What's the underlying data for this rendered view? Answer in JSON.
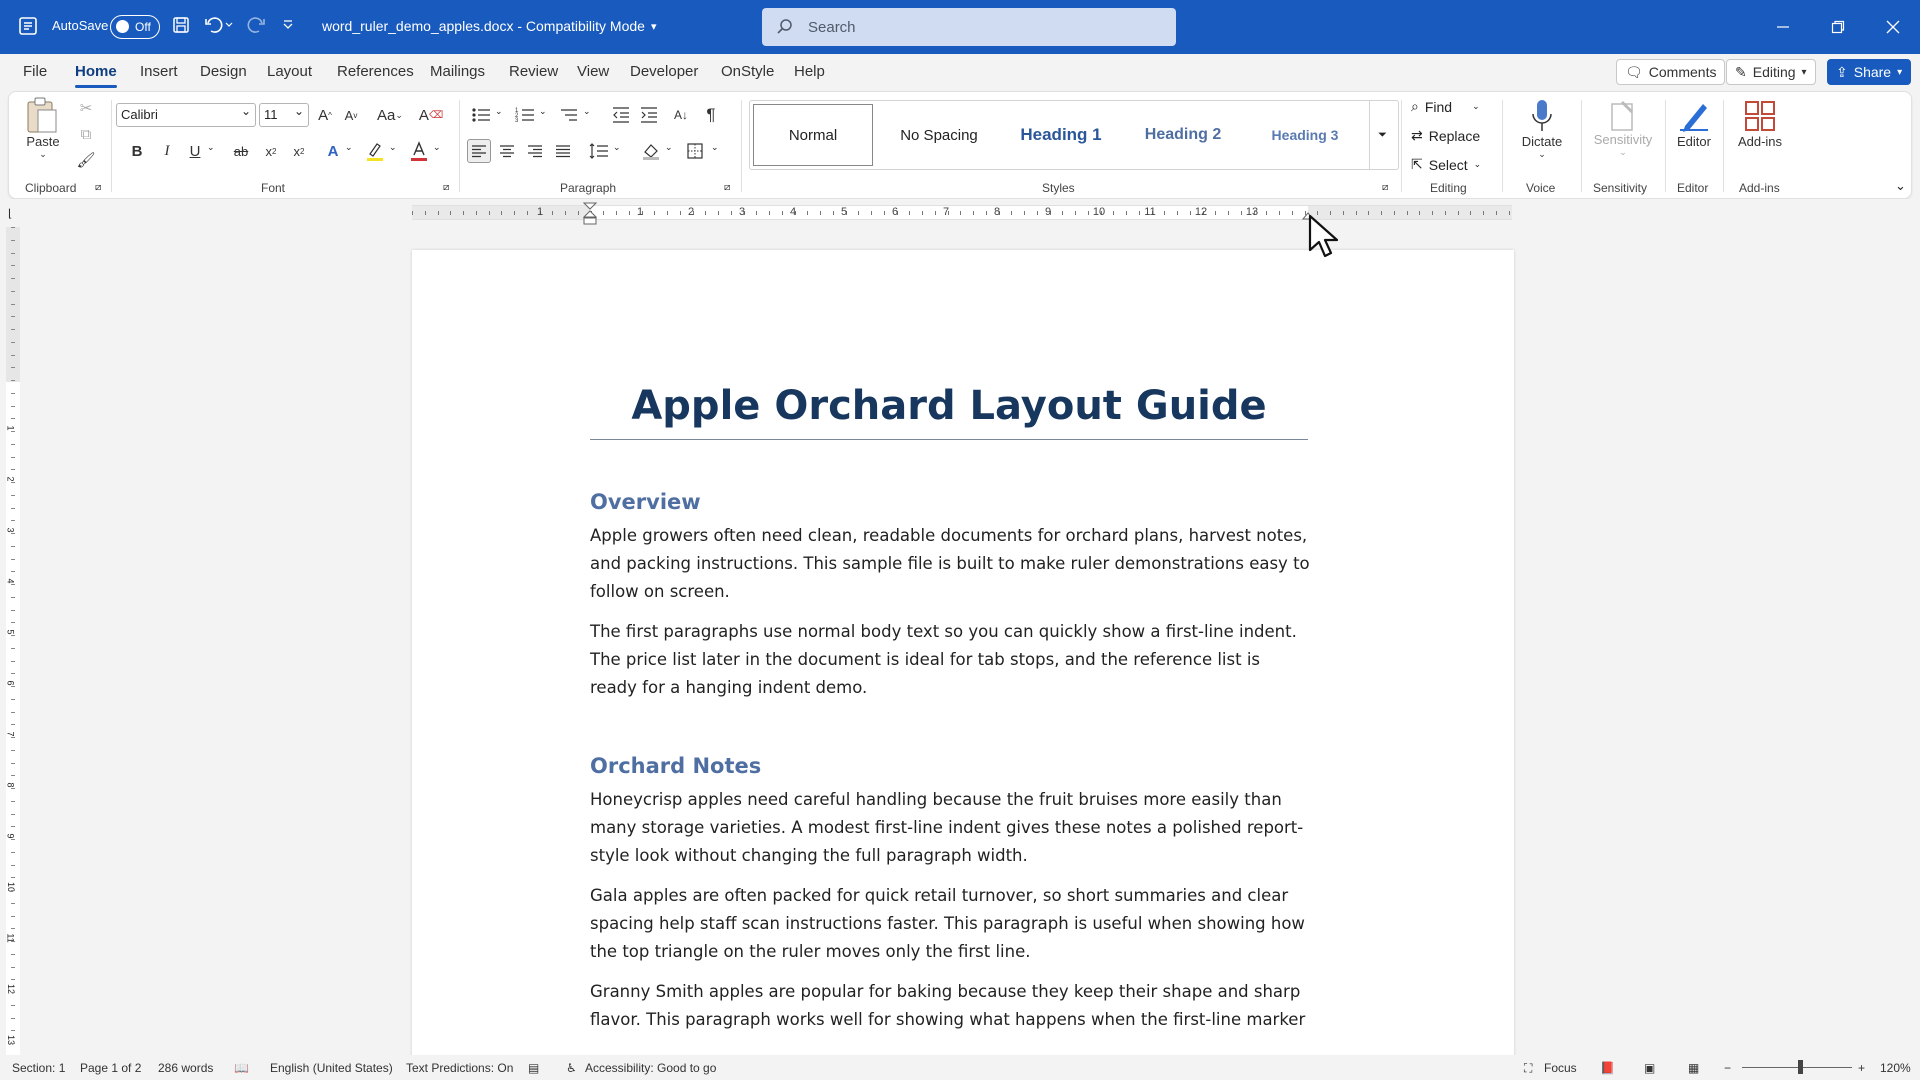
{
  "titlebar": {
    "autosave_label": "AutoSave",
    "autosave_state": "Off",
    "doc_title": "word_ruler_demo_apples.docx  -  Compatibility Mode",
    "search_placeholder": "Search"
  },
  "tabs": [
    "File",
    "Home",
    "Insert",
    "Design",
    "Layout",
    "References",
    "Mailings",
    "Review",
    "View",
    "Developer",
    "OnStyle",
    "Help"
  ],
  "topright": {
    "comments": "Comments",
    "editing": "Editing",
    "share": "Share"
  },
  "ribbon": {
    "clipboard": {
      "paste": "Paste",
      "label": "Clipboard"
    },
    "font": {
      "name": "Calibri",
      "size": "11",
      "label": "Font"
    },
    "paragraph": {
      "label": "Paragraph"
    },
    "styles": {
      "items": [
        "Normal",
        "No Spacing",
        "Heading 1",
        "Heading 2",
        "Heading 3"
      ],
      "label": "Styles"
    },
    "editing": {
      "find": "Find",
      "replace": "Replace",
      "select": "Select",
      "label": "Editing"
    },
    "voice": {
      "dictate": "Dictate",
      "label": "Voice"
    },
    "sensitivity": {
      "button": "Sensitivity",
      "label": "Sensitivity"
    },
    "editor": {
      "button": "Editor",
      "label": "Editor"
    },
    "addins": {
      "button": "Add-ins",
      "label": "Add-ins"
    }
  },
  "ruler": {
    "numbers": [
      "1",
      "1",
      "2",
      "3",
      "4",
      "5",
      "6",
      "7",
      "8",
      "9",
      "10",
      "11",
      "12",
      "13"
    ]
  },
  "vruler": {
    "numbers": [
      "1",
      "2",
      "3",
      "4",
      "5",
      "6",
      "7",
      "8",
      "9",
      "10",
      "11",
      "12",
      "13"
    ]
  },
  "document": {
    "title": "Apple Orchard Layout Guide",
    "sections": [
      {
        "heading": "Overview",
        "paragraphs": [
          "Apple growers often need clean, readable documents for orchard plans, harvest notes, and packing instructions. This sample file is built to make ruler demonstrations easy to follow on screen.",
          "The first paragraphs use normal body text so you can quickly show a first-line indent. The price list later in the document is ideal for tab stops, and the reference list is ready for a hanging indent demo."
        ]
      },
      {
        "heading": "Orchard Notes",
        "paragraphs": [
          "Honeycrisp apples need careful handling because the fruit bruises more easily than many storage varieties. A modest first-line indent gives these notes a polished report-style look without changing the full paragraph width.",
          "Gala apples are often packed for quick retail turnover, so short summaries and clear spacing help staff scan instructions faster. This paragraph is useful when showing how the top triangle on the ruler moves only the first line.",
          "Granny Smith apples are popular for baking because they keep their shape and sharp flavor. This paragraph works well for showing what happens when the first-line marker"
        ]
      }
    ]
  },
  "status": {
    "section": "Section: 1",
    "page": "Page 1 of 2",
    "words": "286 words",
    "language": "English (United States)",
    "predictions": "Text Predictions: On",
    "accessibility": "Accessibility: Good to go",
    "focus": "Focus",
    "zoom": "120%"
  }
}
